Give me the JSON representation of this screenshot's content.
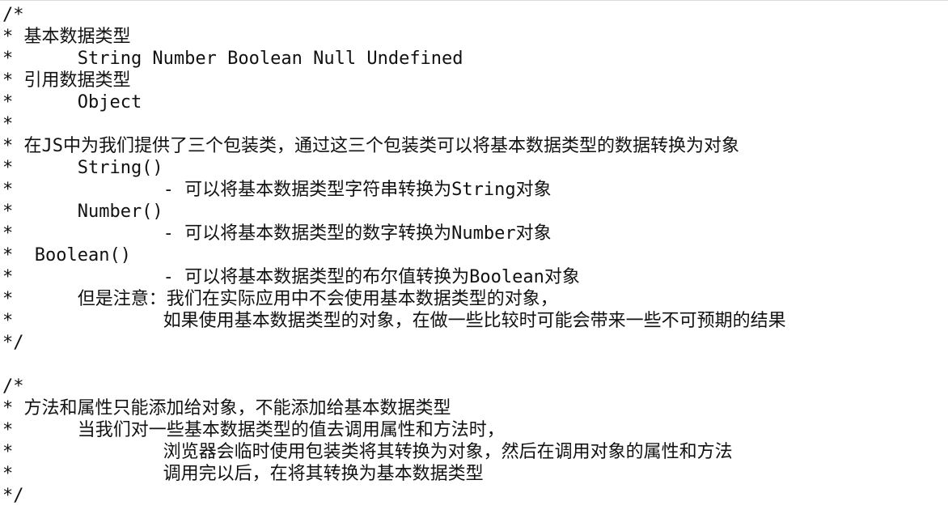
{
  "editor": {
    "lines": [
      "/*",
      "* 基本数据类型",
      "*      String Number Boolean Null Undefined",
      "* 引用数据类型",
      "*      Object",
      "*",
      "* 在JS中为我们提供了三个包装类，通过这三个包装类可以将基本数据类型的数据转换为对象",
      "*      String()",
      "*              - 可以将基本数据类型字符串转换为String对象",
      "*      Number()",
      "*              - 可以将基本数据类型的数字转换为Number对象",
      "*  Boolean()",
      "*              - 可以将基本数据类型的布尔值转换为Boolean对象",
      "*      但是注意：我们在实际应用中不会使用基本数据类型的对象，",
      "*              如果使用基本数据类型的对象，在做一些比较时可能会带来一些不可预期的结果",
      "*/",
      "",
      "/*",
      "* 方法和属性只能添加给对象，不能添加给基本数据类型",
      "*      当我们对一些基本数据类型的值去调用属性和方法时，",
      "*              浏览器会临时使用包装类将其转换为对象，然后在调用对象的属性和方法",
      "*              调用完以后，在将其转换为基本数据类型",
      "*/"
    ]
  }
}
